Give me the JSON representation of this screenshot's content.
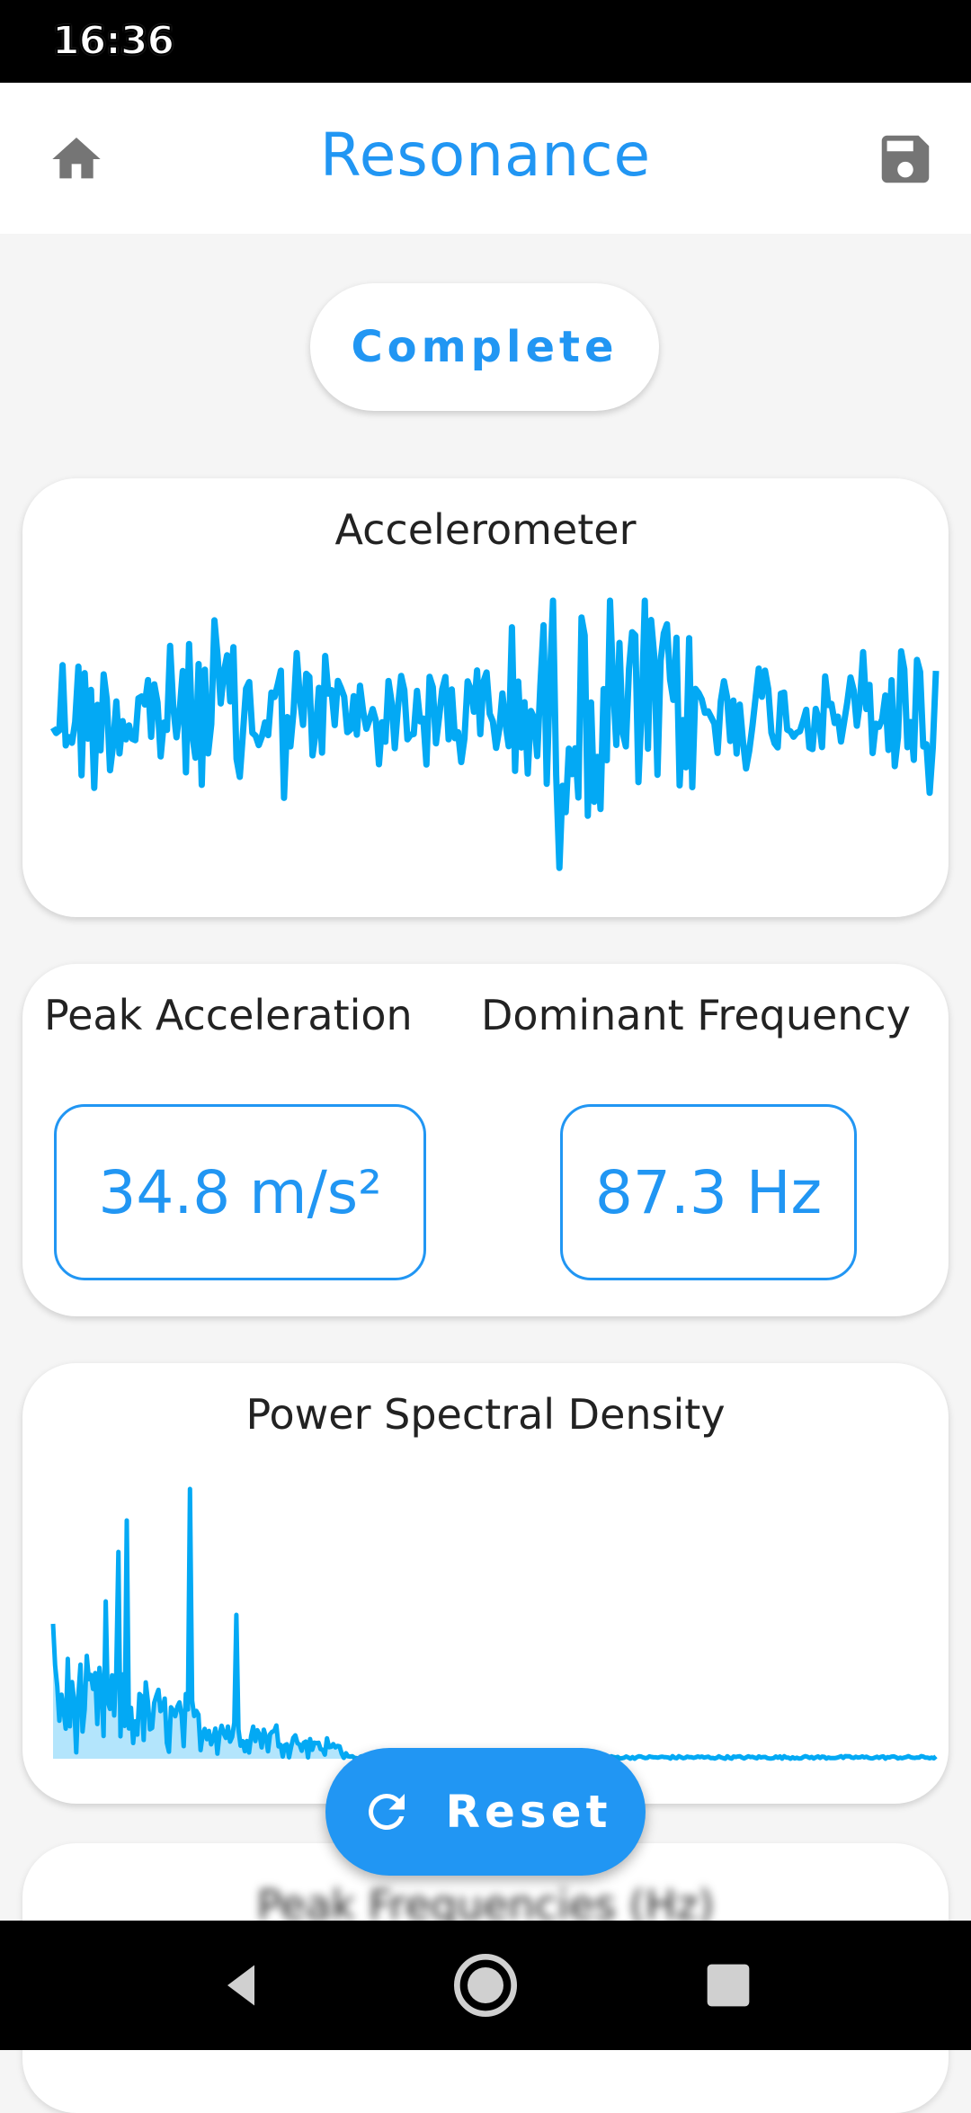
{
  "status_bar": {
    "time": "16:36"
  },
  "app_bar": {
    "title": "Resonance",
    "home_icon": "home-icon",
    "save_icon": "save-icon"
  },
  "status_pill": {
    "label": "Complete"
  },
  "accelerometer_card": {
    "title": "Accelerometer"
  },
  "metrics": {
    "peak_label": "Peak Acceleration",
    "peak_value": "34.8 m/s²",
    "dominant_label": "Dominant Frequency",
    "dominant_value": "87.3 Hz"
  },
  "psd_card": {
    "title": "Power Spectral Density"
  },
  "next_card": {
    "title": "Peak Frequencies (Hz)"
  },
  "reset_button": {
    "label": "Reset",
    "icon": "refresh-icon"
  },
  "nav_bar": {
    "back_icon": "back-triangle-icon",
    "home_icon": "home-circle-icon",
    "recents_icon": "recents-square-icon"
  },
  "colors": {
    "accent": "#2196f3",
    "series": "#03a9f4",
    "series_fill": "#b3e5fc"
  }
}
